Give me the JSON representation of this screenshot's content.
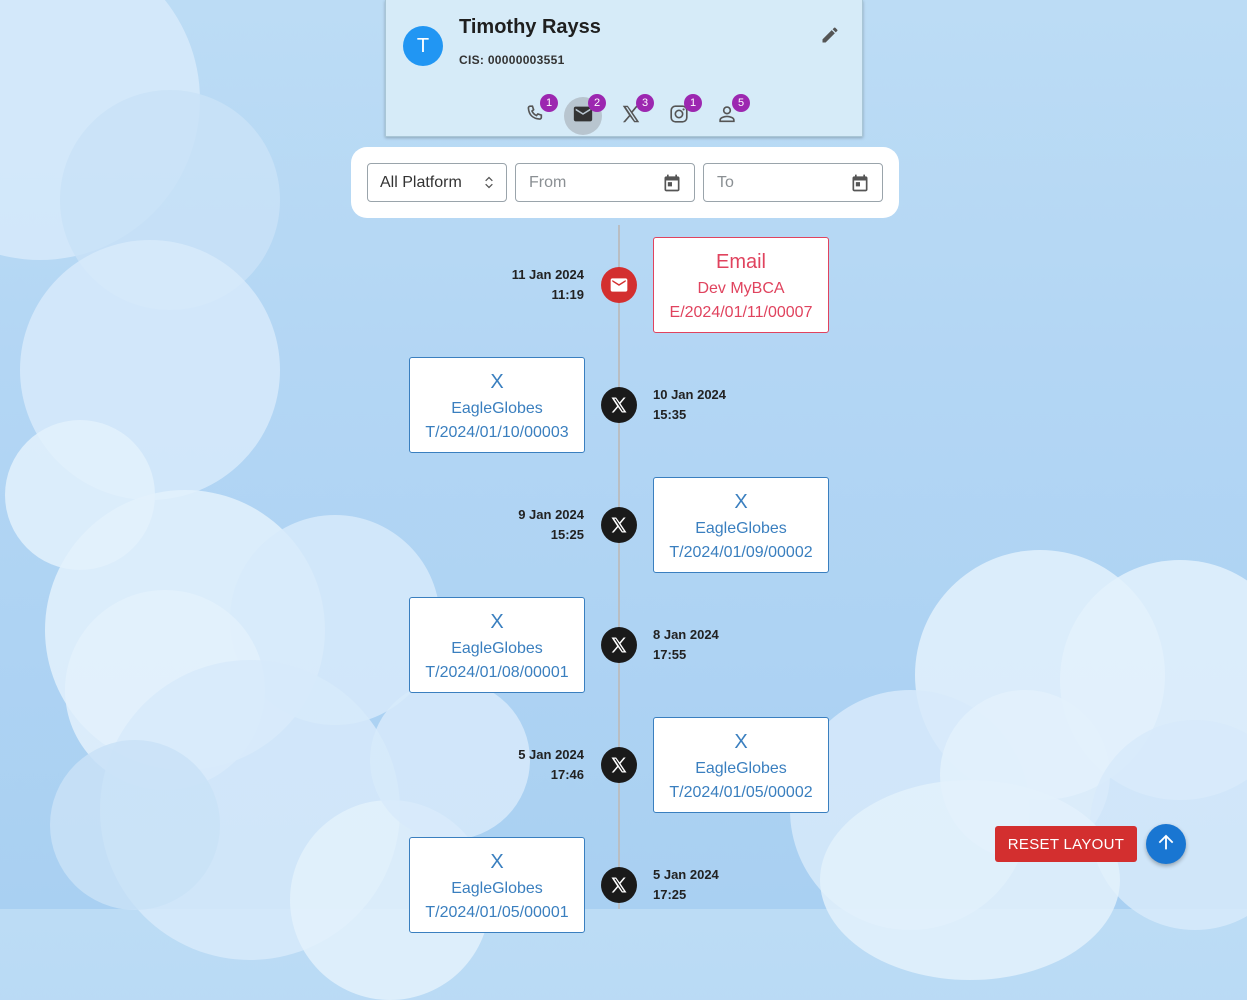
{
  "profile": {
    "avatar_letter": "T",
    "name": "Timothy Rayss",
    "cis": "CIS: 00000003551",
    "channels": [
      {
        "name": "phone-icon",
        "count": "1"
      },
      {
        "name": "email-icon",
        "count": "2"
      },
      {
        "name": "x-icon",
        "count": "3"
      },
      {
        "name": "instagram-icon",
        "count": "1"
      },
      {
        "name": "person-icon",
        "count": "5"
      }
    ]
  },
  "filters": {
    "platform": "All Platform",
    "from_placeholder": "From",
    "to_placeholder": "To"
  },
  "timeline": [
    {
      "date": "11 Jan 2024",
      "time": "11:19",
      "type": "Email",
      "sender": "Dev MyBCA",
      "ref": "E/2024/01/11/00007"
    },
    {
      "date": "10 Jan 2024",
      "time": "15:35",
      "type": "X",
      "sender": "EagleGlobes",
      "ref": "T/2024/01/10/00003"
    },
    {
      "date": "9 Jan 2024",
      "time": "15:25",
      "type": "X",
      "sender": "EagleGlobes",
      "ref": "T/2024/01/09/00002"
    },
    {
      "date": "8 Jan 2024",
      "time": "17:55",
      "type": "X",
      "sender": "EagleGlobes",
      "ref": "T/2024/01/08/00001"
    },
    {
      "date": "5 Jan 2024",
      "time": "17:46",
      "type": "X",
      "sender": "EagleGlobes",
      "ref": "T/2024/01/05/00002"
    },
    {
      "date": "5 Jan 2024",
      "time": "17:25",
      "type": "X",
      "sender": "EagleGlobes",
      "ref": "T/2024/01/05/00001"
    }
  ],
  "actions": {
    "reset_label": "RESET LAYOUT",
    "scroll_top_icon": "arrow-up-icon"
  },
  "colors": {
    "email_accent": "#e0435e",
    "x_accent": "#3a7fbf",
    "badge": "#9c27b0",
    "reset_button": "#d32f2f",
    "fab": "#1976d2"
  }
}
